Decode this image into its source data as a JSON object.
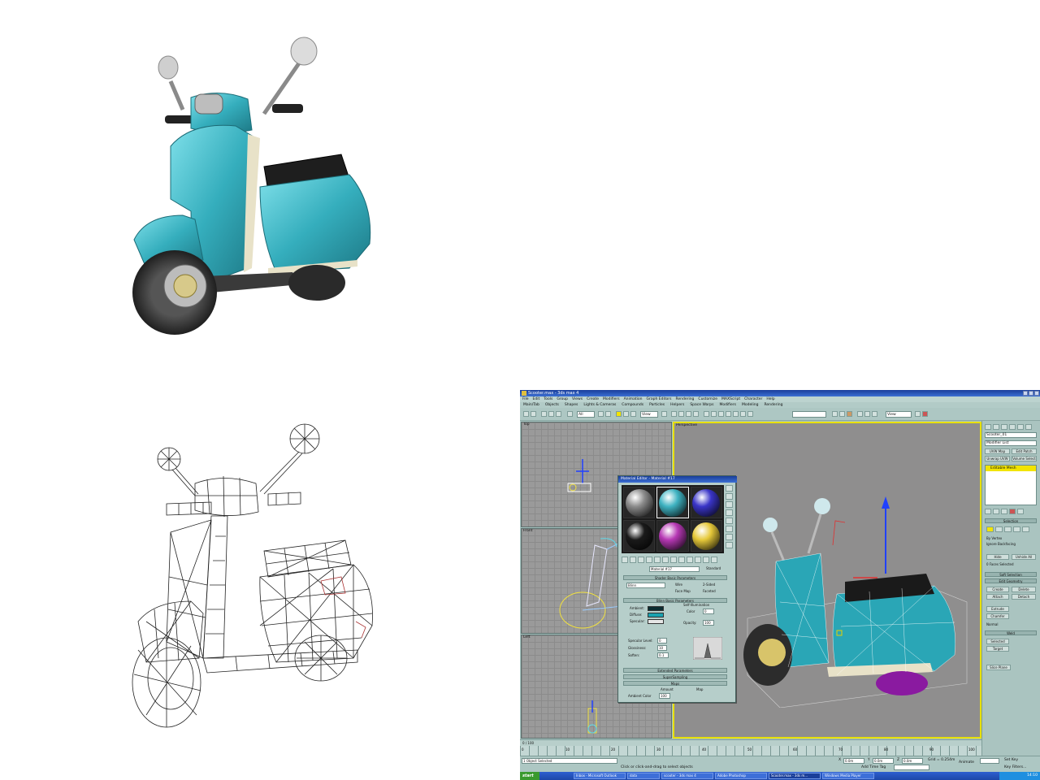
{
  "panel_rendered": {
    "colors": {
      "body": "#3fb3c2",
      "seat": "#1e1e1e",
      "tire": "#2a2a2a"
    }
  },
  "panel_wireframe": {
    "colors": {
      "line": "#222222"
    }
  },
  "max_window": {
    "title": "Scooter.max - 3ds max 4",
    "menu": [
      "File",
      "Edit",
      "Tools",
      "Group",
      "Views",
      "Create",
      "Modifiers",
      "Animation",
      "Graph Editors",
      "Rendering",
      "Customize",
      "MAXScript",
      "Character",
      "Help"
    ],
    "tabs": [
      "Main/Tab",
      "Objects",
      "Shapes",
      "Lights & Cameras",
      "Compounds",
      "Particles",
      "Helpers",
      "Space Warps",
      "Modifiers",
      "Modeling",
      "Rendering"
    ],
    "toolbar": {
      "selection_filter": "All",
      "ref_coord": "View",
      "named_sel": "",
      "render_type": "View"
    },
    "viewports": {
      "top": "Top",
      "front": "Front",
      "left": "Left",
      "perspective": "Perspective"
    },
    "material_editor": {
      "title": "Material Editor - Material #17",
      "material_name": "Material #17",
      "material_type": "Standard",
      "shader": "Blinn",
      "rollouts": {
        "shader_basic": "Shader Basic Parameters",
        "blinn_basic": "Blinn Basic Parameters",
        "extended": "Extended Parameters",
        "supersampling": "SuperSampling",
        "maps": "Maps",
        "self_illum": "Self-Illumination"
      },
      "checks": {
        "wire": "Wire",
        "two_sided": "2-Sided",
        "face_map": "Face Map",
        "faceted": "Faceted"
      },
      "labels": {
        "ambient": "Ambient:",
        "diffuse": "Diffuse:",
        "specular": "Specular:",
        "color": "Color",
        "opacity": "Opacity:",
        "spec_level": "Specular Level:",
        "glossiness": "Glossiness:",
        "soften": "Soften:",
        "amount": "Amount",
        "map": "Map",
        "ambient_color": "Ambient Color"
      },
      "values": {
        "opacity": "100",
        "spec_level": "0",
        "glossiness": "10",
        "soften": "0.1",
        "self_illum": "0",
        "ambient_amt": "100"
      },
      "colors": {
        "ambient": "#0b2c30",
        "diffuse": "#1aa3b0",
        "specular": "#e6e6e6"
      },
      "ball_colors": [
        "#8c8c8c",
        "#3fb3c2",
        "#3a35c8",
        "#1a1a1a",
        "#b638b4",
        "#e6c93a"
      ]
    },
    "command_panel": {
      "object_name": "Scooter_01",
      "modifier_list": "Modifier List",
      "buttons": [
        "UVW Map",
        "Edit Patch",
        "Unwrap UVW",
        "Volume Select"
      ],
      "stack_item": "Editable Mesh",
      "rollouts": {
        "selection": "Selection",
        "soft_selection": "Soft Selection",
        "edit_geometry": "Edit Geometry"
      },
      "labels": {
        "by_vertex": "By Vertex",
        "ignore_backfacing": "Ignore Backfacing",
        "hide": "Hide",
        "unhide_all": "Unhide All",
        "create": "Create",
        "delete": "Delete",
        "attach": "Attach",
        "detach": "Detach",
        "extrude": "Extrude",
        "chamfer": "Chamfer",
        "normal": "Normal",
        "weld": "Weld",
        "selected": "Selected",
        "target": "Target",
        "slice_plane": "Slice Plane",
        "remove_isolated": "Remove Isolated Vertices",
        "face_sel": "0 Faces Selected"
      }
    },
    "timeline": {
      "frame": "0 / 100",
      "ticks": [
        "0",
        "10",
        "20",
        "30",
        "40",
        "50",
        "60",
        "70",
        "80",
        "90",
        "100"
      ]
    },
    "status": {
      "selected": "1 Object Selected",
      "prompt": "Click or click-and-drag to select objects",
      "x": "0.0m",
      "y": "0.0m",
      "z": "0.0m",
      "grid": "Grid = 0.254m",
      "add_time_tag": "Add Time Tag",
      "animate": "Animate",
      "set_key": "Set Key",
      "key_filters": "Key Filters..."
    },
    "taskbar": {
      "start": "start",
      "items": [
        "Inbox - Microsoft Outlook",
        "data",
        "scooter - 3ds max 4",
        "Adobe Photoshop",
        "Scooter.max - 3ds m...",
        "Windows Media Player"
      ],
      "clock": "14:10"
    }
  }
}
